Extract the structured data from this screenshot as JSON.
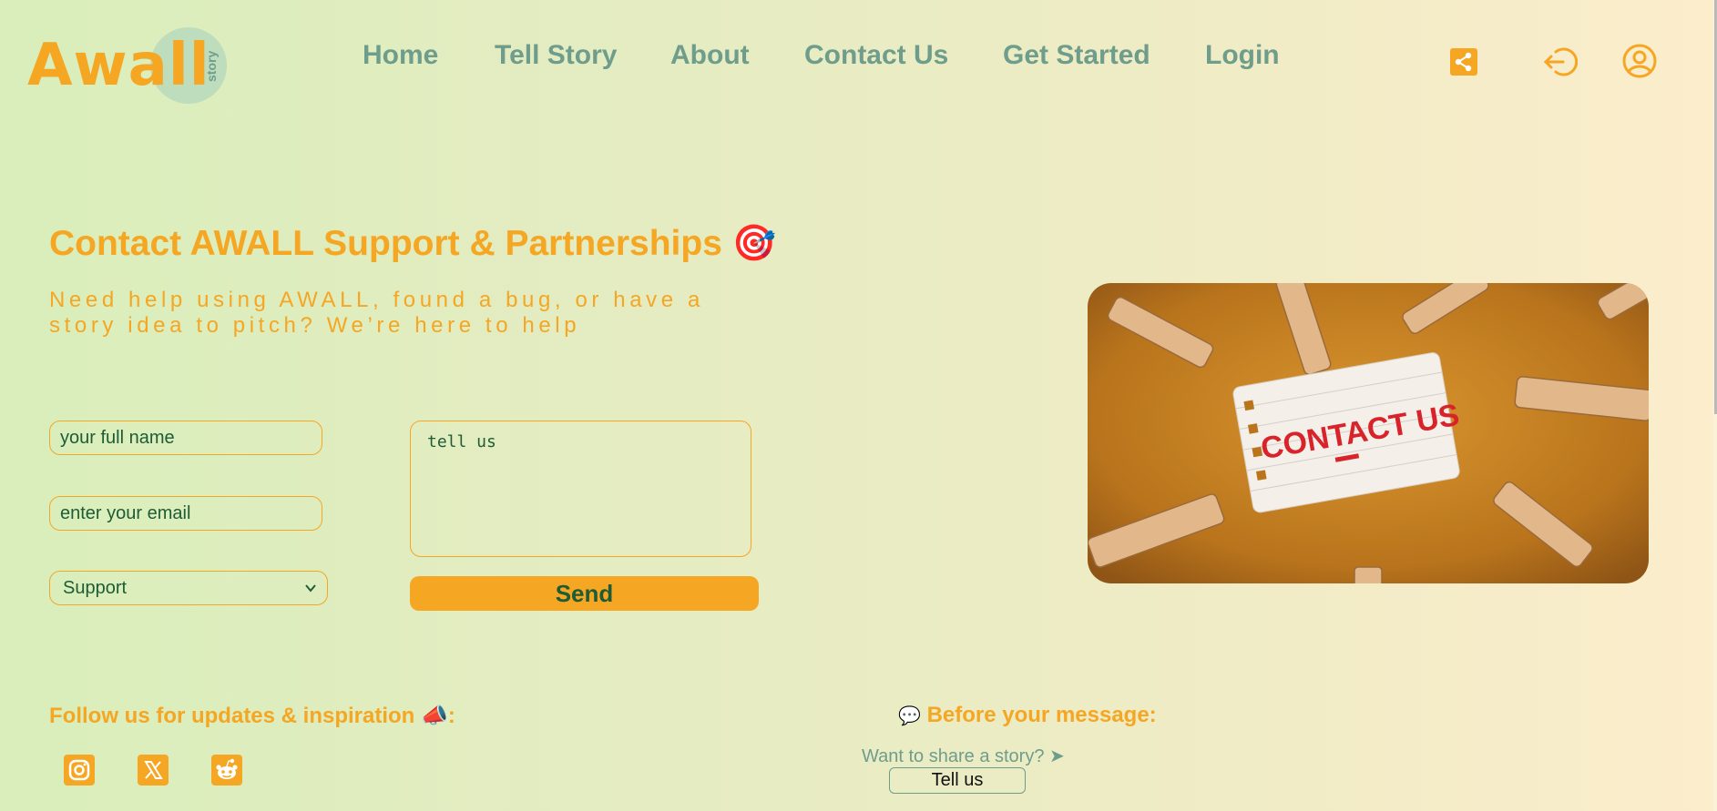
{
  "header": {
    "logo": {
      "text": "Awall",
      "sub": "story"
    },
    "nav": [
      {
        "label": "Home"
      },
      {
        "label": "Tell Story"
      },
      {
        "label": "About"
      },
      {
        "label": "Contact Us"
      },
      {
        "label": "Get Started"
      },
      {
        "label": "Login"
      }
    ],
    "icons": [
      "share-icon",
      "logout-icon",
      "user-icon"
    ]
  },
  "hero": {
    "title": "Contact AWALL Support & Partnerships",
    "title_emoji": "🎯",
    "subtitle": "Need help using AWALL, found a bug, or have a story idea to pitch? We’re here to help"
  },
  "form": {
    "name_placeholder": "your full name",
    "email_placeholder": "enter your email",
    "topic_selected": "Support",
    "message_placeholder": "tell us",
    "send_label": "Send"
  },
  "image": {
    "note_text": "CONTACT US"
  },
  "footer": {
    "follow_label": "Follow us for updates & inspiration",
    "follow_emoji": "📣",
    "follow_suffix": ":",
    "before_emoji": "💬",
    "before_label": "Before your message:",
    "share_question": "Want to share a story? ➤",
    "tell_us_label": "Tell us",
    "social": [
      "instagram-icon",
      "x-icon",
      "reddit-icon"
    ]
  },
  "colors": {
    "accent": "#f5a623",
    "nav": "#6f9d8c",
    "text_dark": "#1e5c35"
  }
}
